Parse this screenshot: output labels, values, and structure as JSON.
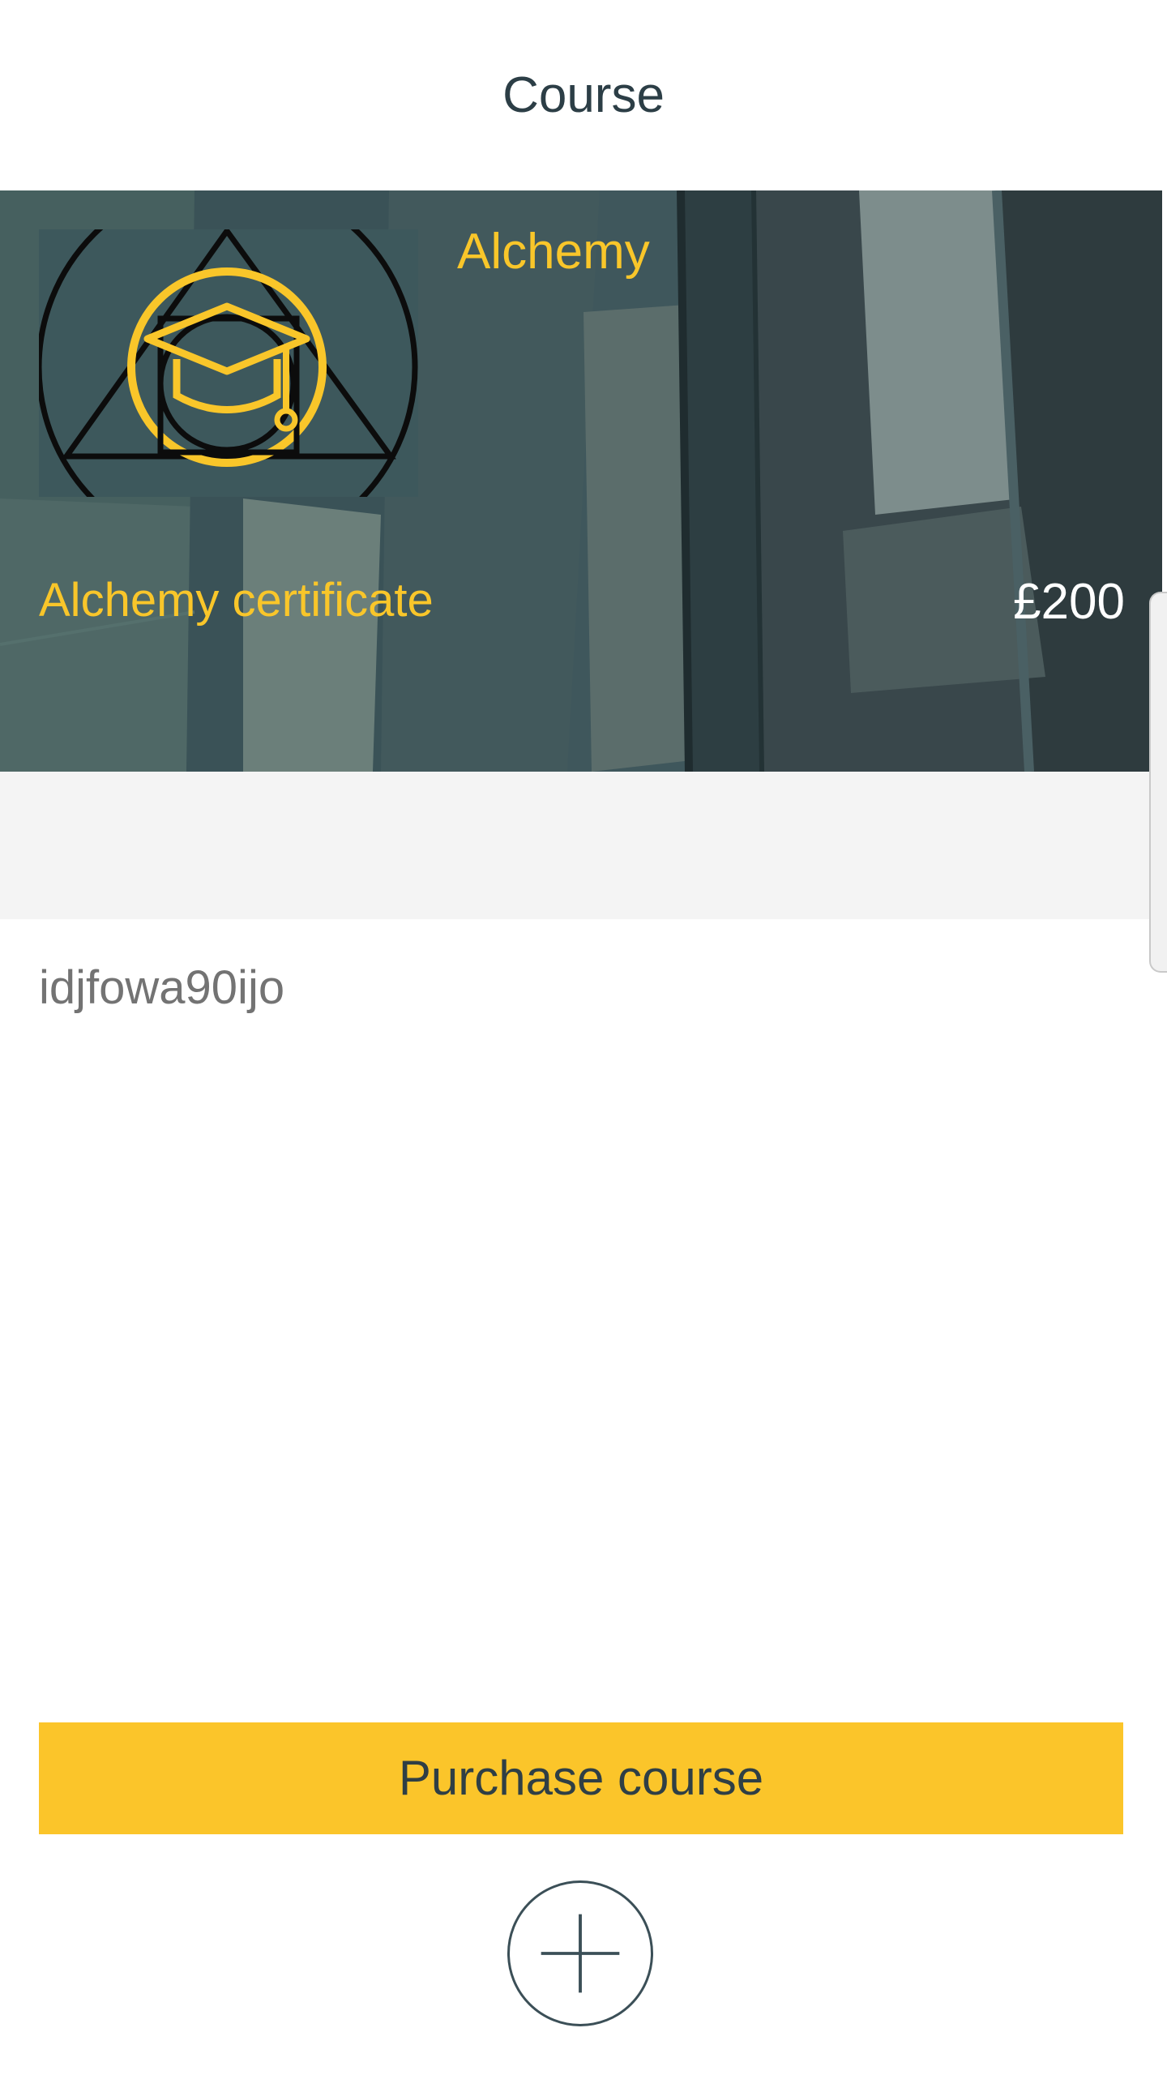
{
  "header": {
    "title": "Course"
  },
  "course": {
    "provider": "Alchemy",
    "title": "Alchemy certificate",
    "price": "£200",
    "description": "idjfowa90ijo"
  },
  "actions": {
    "purchase_label": "Purchase course"
  },
  "icons": {
    "logo": "alchemy-graduation-cap-logo",
    "add": "plus-icon"
  },
  "colors": {
    "accent": "#fbc52a",
    "hero_overlay": "#3c5358",
    "text_dark": "#2c3e46",
    "text_muted": "#737373"
  }
}
